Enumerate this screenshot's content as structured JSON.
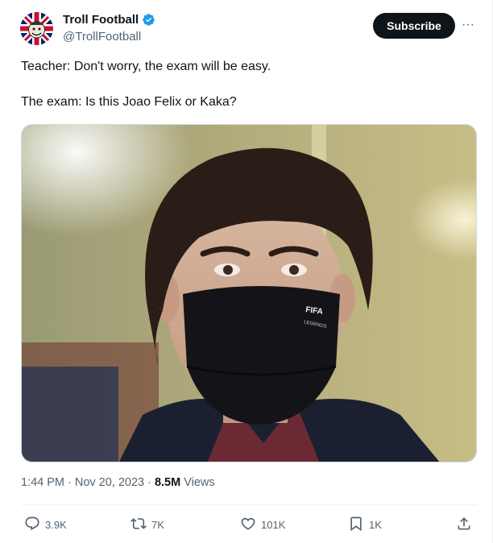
{
  "tweet": {
    "author_name": "Troll Football",
    "author_handle": "@TrollFootball",
    "subscribe_label": "Subscribe",
    "more_label": "···",
    "text_line_1": "Teacher: Don't worry, the exam will be easy.",
    "text_line_2": "The exam: Is this Joao Felix or Kaka?",
    "mask_text_1": "FIFA",
    "mask_text_2": "LEGENDS",
    "time": "1:44 PM",
    "dot": "·",
    "date": "Nov 20, 2023",
    "dot2": "·",
    "views_count": "8.5M",
    "views_label": "Views"
  },
  "actions": {
    "replies": "3.9K",
    "reposts": "7K",
    "likes": "101K",
    "bookmarks": "1K"
  },
  "colors": {
    "verified": "#1d9bf0",
    "muted": "#536471",
    "text": "#0f1419"
  },
  "icons": [
    "verified-icon",
    "reply-icon",
    "repost-icon",
    "like-icon",
    "bookmark-icon",
    "share-icon",
    "more-icon"
  ]
}
